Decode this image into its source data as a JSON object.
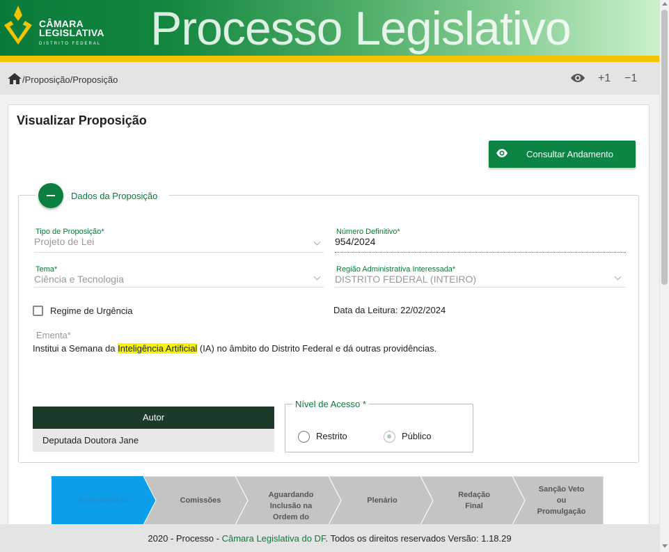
{
  "header": {
    "logo_line1": "CÂMARA",
    "logo_line2": "LEGISLATIVA",
    "logo_line3": "DISTRITO FEDERAL",
    "title": "Processo Legislativo"
  },
  "breadcrumb": {
    "text": "/Proposição/Proposição",
    "font_increase": "+1",
    "font_decrease": "−1"
  },
  "page": {
    "title": "Visualizar Proposição",
    "consult_button": "Consultar Andamento"
  },
  "section": {
    "legend": "Dados da Proposição",
    "fields": {
      "tipo_label": "Tipo de Proposição*",
      "tipo_value": "Projeto de Lei",
      "numero_label": "Número Definitivo*",
      "numero_value": "954/2024",
      "tema_label": "Tema*",
      "tema_value": "Ciência e Tecnologia",
      "regiao_label": "Região Administrativa Interessada*",
      "regiao_value": "DISTRITO FEDERAL (INTEIRO)"
    },
    "urgencia_label": "Regime de Urgência",
    "leitura": "Data da Leitura: 22/02/2024",
    "ementa_label": "Ementa*",
    "ementa_before": "Institui a Semana da ",
    "ementa_highlight": "Inteligência Artificial",
    "ementa_after": " (IA) no âmbito do Distrito Federal e dá outras providências.",
    "autor": {
      "header": "Autor",
      "rows": [
        "Deputada Doutora Jane"
      ]
    },
    "nivel": {
      "legend": "Nível de Acesso *",
      "options": [
        {
          "label": "Restrito",
          "checked": false
        },
        {
          "label": "Público",
          "checked": true
        }
      ]
    }
  },
  "stepper": {
    "steps": [
      {
        "label": "Apresentação",
        "active": true
      },
      {
        "label": "Comissões",
        "active": false
      },
      {
        "label": "Aguardando Inclusão na Ordem do Dia",
        "active": false
      },
      {
        "label": "Plenário",
        "active": false
      },
      {
        "label": "Redação Final",
        "active": false
      },
      {
        "label": "Sanção Veto ou Promulgação",
        "active": false
      }
    ],
    "active_color": "#0c9ee8",
    "inactive_color": "#c4c4c4"
  },
  "footer": {
    "prefix": "2020 - Processo - ",
    "link": "Câmara Legislativa do DF",
    "suffix": ". Todos os direitos reservados   Versão: 1.18.29"
  },
  "colors": {
    "brand_green": "#0c8444",
    "gold": "#f4c400"
  }
}
